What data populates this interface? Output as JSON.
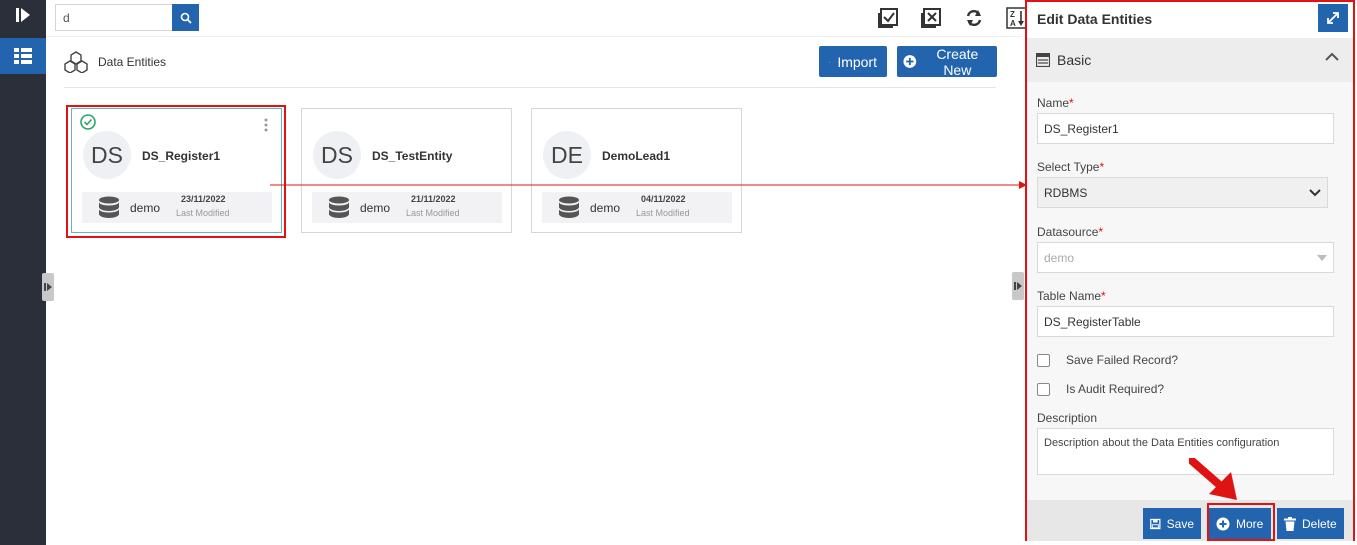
{
  "search": {
    "value": "d",
    "placeholder": ""
  },
  "header": {
    "title": "Data Entities",
    "import_label": "Import",
    "create_label": "Create New"
  },
  "cards": [
    {
      "initials": "DS",
      "name": "DS_Register1",
      "datasource": "demo",
      "date": "23/11/2022",
      "modified_label": "Last Modified",
      "selected": true
    },
    {
      "initials": "DS",
      "name": "DS_TestEntity",
      "datasource": "demo",
      "date": "21/11/2022",
      "modified_label": "Last Modified",
      "selected": false
    },
    {
      "initials": "DE",
      "name": "DemoLead1",
      "datasource": "demo",
      "date": "04/11/2022",
      "modified_label": "Last Modified",
      "selected": false
    }
  ],
  "panel": {
    "title": "Edit Data Entities",
    "section": "Basic",
    "fields": {
      "name_label": "Name",
      "name_value": "DS_Register1",
      "type_label": "Select Type",
      "type_value": "RDBMS",
      "datasource_label": "Datasource",
      "datasource_value": "demo",
      "table_label": "Table Name",
      "table_value": "DS_RegisterTable",
      "save_failed_label": "Save Failed Record?",
      "audit_label": "Is Audit Required?",
      "description_label": "Description",
      "description_value": "Description about the Data Entities configuration",
      "required_mark": "*"
    },
    "buttons": {
      "save": "Save",
      "more": "More",
      "delete": "Delete"
    }
  },
  "colors": {
    "primary": "#2364ae",
    "nav_bg": "#2b2f3a",
    "highlight": "#e01313",
    "success": "#2ca66b"
  }
}
